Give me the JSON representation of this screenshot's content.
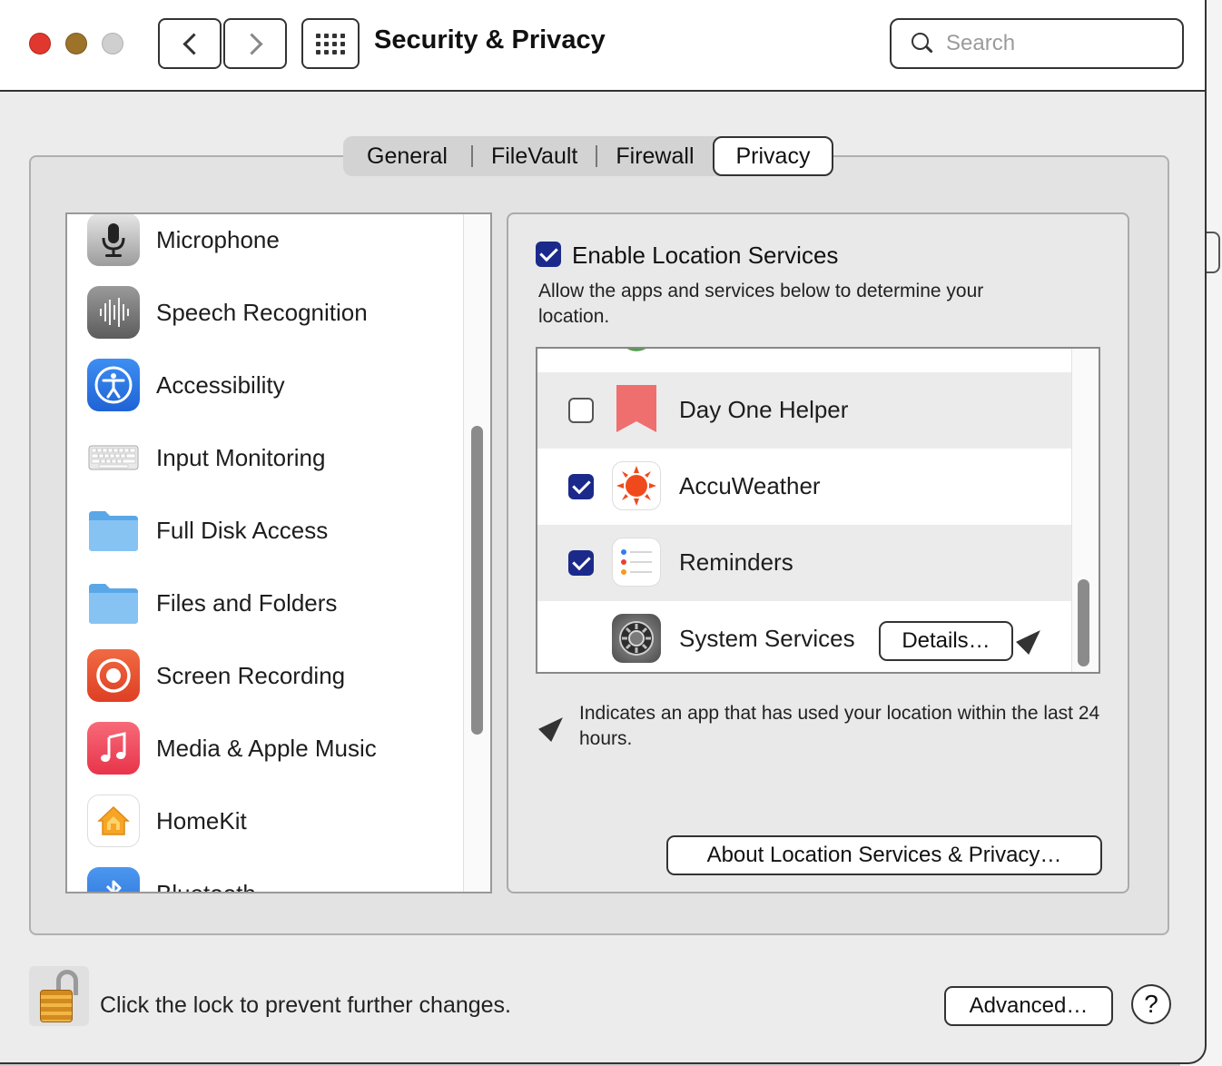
{
  "window": {
    "title": "Security & Privacy"
  },
  "search": {
    "placeholder": "Search"
  },
  "tabs": [
    {
      "label": "General"
    },
    {
      "label": "FileVault"
    },
    {
      "label": "Firewall"
    },
    {
      "label": "Privacy",
      "selected": true
    }
  ],
  "privacy_list": {
    "items": [
      {
        "label": "Microphone",
        "icon": "microphone-icon"
      },
      {
        "label": "Speech Recognition",
        "icon": "waveform-icon"
      },
      {
        "label": "Accessibility",
        "icon": "accessibility-icon"
      },
      {
        "label": "Input Monitoring",
        "icon": "keyboard-icon"
      },
      {
        "label": "Full Disk Access",
        "icon": "folder-icon"
      },
      {
        "label": "Files and Folders",
        "icon": "folder-icon"
      },
      {
        "label": "Screen Recording",
        "icon": "screen-recording-icon"
      },
      {
        "label": "Media & Apple Music",
        "icon": "music-note-icon"
      },
      {
        "label": "HomeKit",
        "icon": "home-icon"
      },
      {
        "label": "Bluetooth",
        "icon": "bluetooth-icon"
      }
    ]
  },
  "location": {
    "enable_label": "Enable Location Services",
    "enabled": true,
    "description": "Allow the apps and services below to determine your location.",
    "apps": [
      {
        "label": "Day One Helper",
        "checked": false,
        "icon": "bookmark-icon"
      },
      {
        "label": "AccuWeather",
        "checked": true,
        "icon": "sun-icon"
      },
      {
        "label": "Reminders",
        "checked": true,
        "icon": "reminders-list-icon"
      },
      {
        "label": "System Services",
        "icon": "gear-icon",
        "details_label": "Details…",
        "recent": true
      }
    ],
    "legend": "Indicates an app that has used your location within the last 24 hours.",
    "about_label": "About Location Services & Privacy…"
  },
  "footer": {
    "lock_text": "Click the lock to prevent further changes.",
    "advanced_label": "Advanced…",
    "help_label": "?"
  },
  "colors": {
    "checkbox_on": "#1b2a8a",
    "close": "#e0382f",
    "minimize": "#9d7329"
  }
}
